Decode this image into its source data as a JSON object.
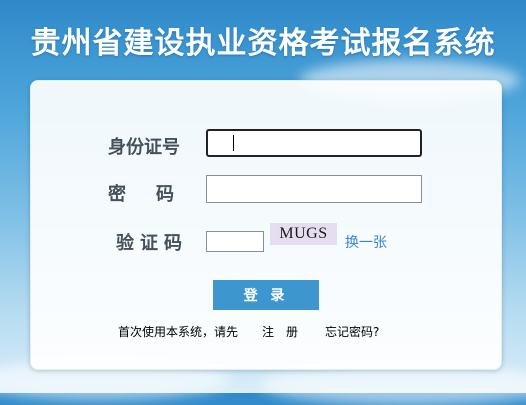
{
  "page": {
    "title": "贵州省建设执业资格考试报名系统"
  },
  "form": {
    "id_label": "身份证号",
    "password_label": "密　码",
    "captcha_label": "验证码",
    "id_value": "",
    "password_value": "",
    "captcha_value": "",
    "captcha_image_text": "MUGS",
    "refresh_label": "换一张",
    "login_label": "登 录"
  },
  "footer": {
    "hint": "首次使用本系统，请先",
    "register_label": "注　册",
    "forgot_label": "忘记密码?"
  }
}
